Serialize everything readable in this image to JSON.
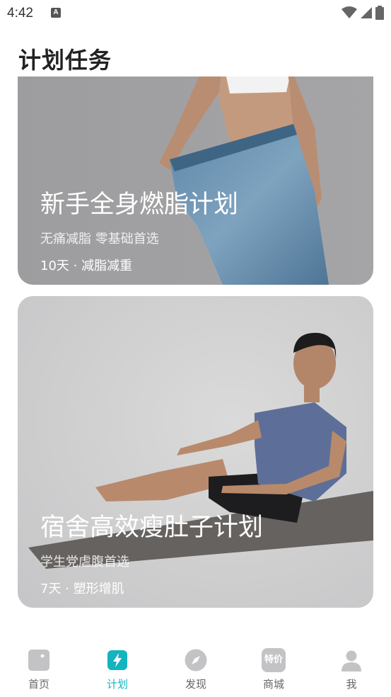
{
  "status_bar": {
    "time": "4:42",
    "notification_icon": "a-notification-icon",
    "icons": [
      "wifi-icon",
      "signal-icon",
      "battery-icon"
    ]
  },
  "page": {
    "title": "计划任务"
  },
  "plans": [
    {
      "title": "新手全身燃脂计划",
      "subtitle": "无痛减脂 零基础首选",
      "meta": "10天 · 减脂减重"
    },
    {
      "title": "宿舍高效瘦肚子计划",
      "subtitle": "学生党虐腹首选",
      "meta": "7天 · 塑形增肌"
    }
  ],
  "tab_bar": {
    "active_color": "#13b3c0",
    "tabs": [
      {
        "label": "首页",
        "icon": "home-icon"
      },
      {
        "label": "计划",
        "icon": "plan-bolt-icon",
        "active": true
      },
      {
        "label": "发现",
        "icon": "compass-icon"
      },
      {
        "label": "商城",
        "icon": "sale-icon",
        "badge": "特价"
      },
      {
        "label": "我",
        "icon": "user-icon"
      }
    ]
  }
}
